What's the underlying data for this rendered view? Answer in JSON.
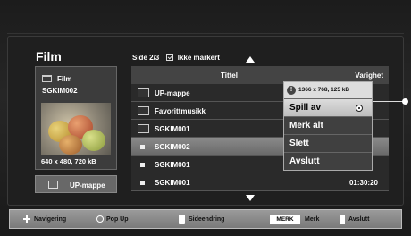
{
  "header": {
    "title": "Film",
    "page_info": "Side 2/3",
    "mark_status": "Ikke markert"
  },
  "preview": {
    "folder_label": "Film",
    "file_name": "SGKIM002",
    "resolution": "640 x 480, 720 kB"
  },
  "up_button": {
    "label": "UP-mappe"
  },
  "table": {
    "col_title": "Tittel",
    "col_duration": "Varighet",
    "rows": [
      {
        "name": "UP-mappe",
        "type": "up-folder",
        "duration": ""
      },
      {
        "name": "Favorittmusikk",
        "type": "folder",
        "duration": ""
      },
      {
        "name": "SGKIM001",
        "type": "folder",
        "duration": ""
      },
      {
        "name": "SGKIM002",
        "type": "file",
        "duration": "",
        "selected": true
      },
      {
        "name": "SGKIM001",
        "type": "file",
        "duration": ""
      },
      {
        "name": "SGKIM001",
        "type": "file",
        "duration": "01:30:20"
      }
    ]
  },
  "popup": {
    "info": "1366 x 768, 125 kB",
    "items": [
      "Spill av",
      "Merk alt",
      "Slett",
      "Avslutt"
    ]
  },
  "footer": {
    "navigate": "Navigering",
    "popup": "Pop Up",
    "page_change": "Sideendring",
    "mark_key": "MERK",
    "mark": "Merk",
    "exit": "Avslutt"
  }
}
